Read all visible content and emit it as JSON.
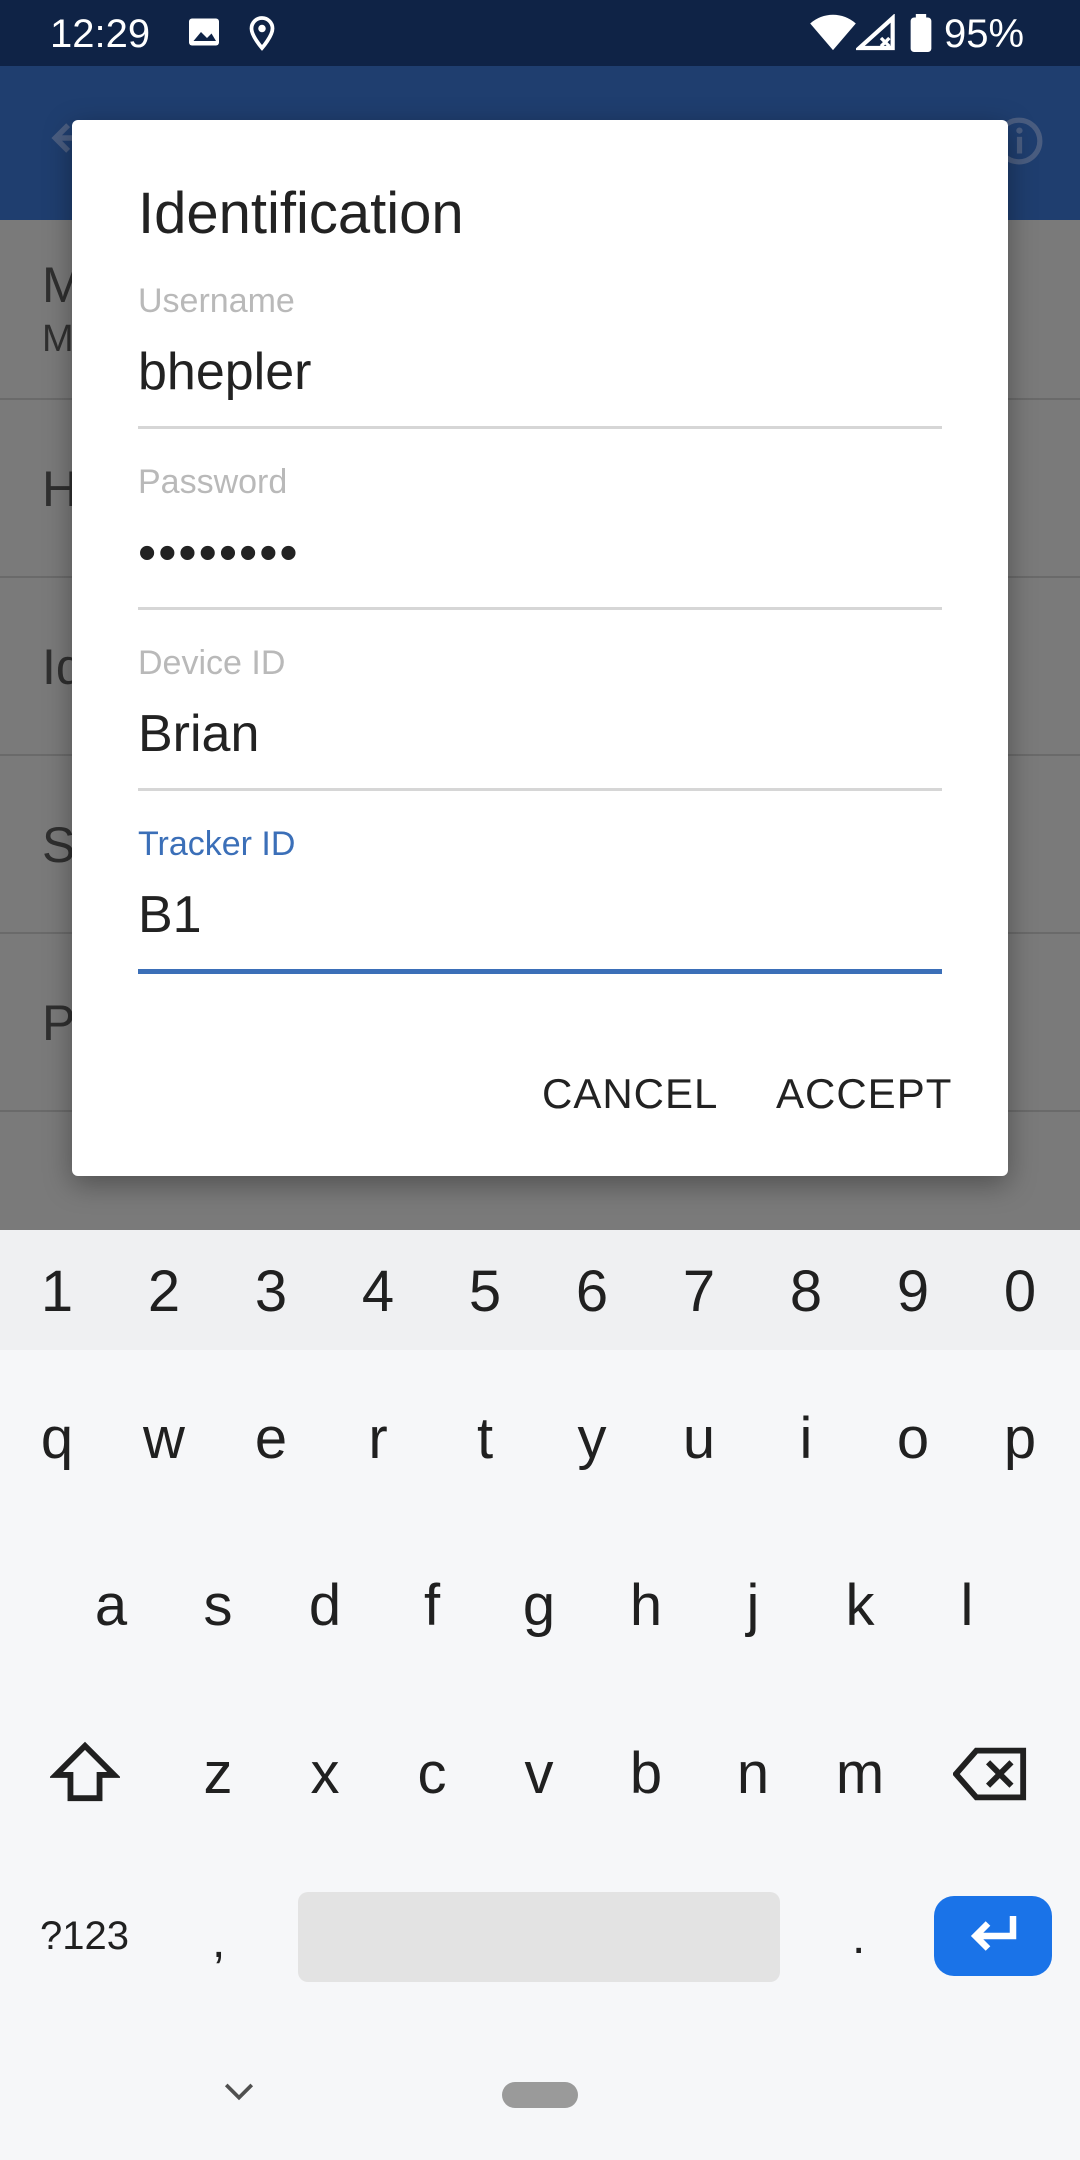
{
  "status_bar": {
    "time": "12:29",
    "battery": "95%"
  },
  "background": {
    "rows": [
      "M",
      "H",
      "Id",
      "S",
      "P"
    ],
    "row1_sub": "M"
  },
  "dialog": {
    "title": "Identification",
    "fields": [
      {
        "label": "Username",
        "value": "bhepler"
      },
      {
        "label": "Password",
        "value": "••••••••"
      },
      {
        "label": "Device ID",
        "value": "Brian"
      },
      {
        "label": "Tracker ID",
        "value": "B1"
      }
    ],
    "cancel_label": "CANCEL",
    "accept_label": "ACCEPT"
  },
  "keyboard": {
    "numbers": [
      "1",
      "2",
      "3",
      "4",
      "5",
      "6",
      "7",
      "8",
      "9",
      "0"
    ],
    "row1": [
      "q",
      "w",
      "e",
      "r",
      "t",
      "y",
      "u",
      "i",
      "o",
      "p"
    ],
    "row2": [
      "a",
      "s",
      "d",
      "f",
      "g",
      "h",
      "j",
      "k",
      "l"
    ],
    "row3": [
      "z",
      "x",
      "c",
      "v",
      "b",
      "n",
      "m"
    ],
    "symbols_label": "?123",
    "comma": ",",
    "period": "."
  },
  "colors": {
    "accent": "#3b6fb8",
    "enter_key": "#1a73e8"
  }
}
